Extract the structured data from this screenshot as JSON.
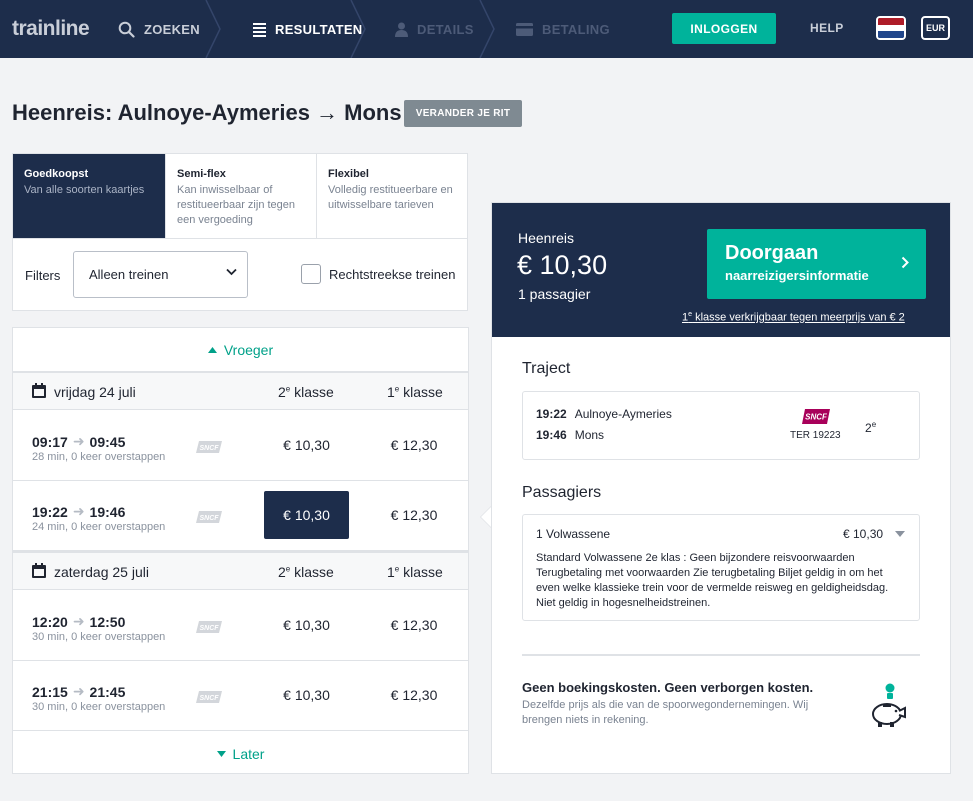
{
  "nav": {
    "logo": "trainline",
    "steps": [
      {
        "label": "ZOEKEN",
        "state": "done"
      },
      {
        "label": "RESULTATEN",
        "state": "active"
      },
      {
        "label": "DETAILS",
        "state": "disabled"
      },
      {
        "label": "BETALING",
        "state": "disabled"
      }
    ],
    "login": "INLOGGEN",
    "help": "HELP",
    "currency": "EUR",
    "flag_colors": [
      "#ae1c28",
      "#ffffff",
      "#21468b"
    ]
  },
  "heading": {
    "title": "Heenreis: Aulnoye-Aymeries → Mons",
    "change_button": "VERANDER JE RIT"
  },
  "fare_tabs": [
    {
      "title": "Goedkoopst",
      "desc": "Van alle soorten kaartjes",
      "active": true
    },
    {
      "title": "Semi-flex",
      "desc": "Kan inwisselbaar of restitueerbaar zijn tegen een vergoeding",
      "active": false
    },
    {
      "title": "Flexibel",
      "desc": "Volledig restitueerbare en uitwisselbare tarieven",
      "active": false
    }
  ],
  "filters": {
    "label": "Filters",
    "select_value": "Alleen treinen",
    "checkbox_label": "Rechtstreekse treinen",
    "checkbox_checked": false
  },
  "results": {
    "earlier": "Vroeger",
    "later": "Later",
    "class2": "2",
    "class1": "1",
    "class_sup": "e",
    "class_word": " klasse",
    "days": [
      {
        "date": "vrijdag 24 juli",
        "journeys": [
          {
            "dep": "09:17",
            "arr": "09:45",
            "info": "28 min, 0 keer overstappen",
            "price2": "€ 10,30",
            "price1": "€ 12,30",
            "selected": false
          },
          {
            "dep": "19:22",
            "arr": "19:46",
            "info": "24 min, 0 keer overstappen",
            "price2": "€ 10,30",
            "price1": "€ 12,30",
            "selected": true
          }
        ]
      },
      {
        "date": "zaterdag 25 juli",
        "journeys": [
          {
            "dep": "12:20",
            "arr": "12:50",
            "info": "30 min, 0 keer overstappen",
            "price2": "€ 10,30",
            "price1": "€ 12,30",
            "selected": false
          },
          {
            "dep": "21:15",
            "arr": "21:45",
            "info": "30 min, 0 keer overstappen",
            "price2": "€ 10,30",
            "price1": "€ 12,30",
            "selected": false
          }
        ]
      }
    ],
    "operator": "SNCF"
  },
  "summary": {
    "label": "Heenreis",
    "price": "€ 10,30",
    "passengers": "1 passagier",
    "go_title": "Doorgaan",
    "go_sub": "naarreizigersinformatie",
    "first_class_sup": "1",
    "first_class_e": "e",
    "first_class_text": " klasse verkrijgbaar tegen meerprijs van € 2",
    "traject_title": "Traject",
    "traject": {
      "dep_time": "19:22",
      "dep_station": "Aulnoye-Aymeries",
      "arr_time": "19:46",
      "arr_station": "Mons",
      "operator": "SNCF",
      "train": "TER 19223",
      "class": "2",
      "class_sup": "e"
    },
    "passengers_title": "Passagiers",
    "passenger": {
      "name": "1 Volwassene",
      "price": "€ 10,30",
      "desc": "Standard Volwassene 2e klas : Geen bijzondere reisvoorwaarden Terugbetaling met voorwaarden Zie terugbetaling Biljet geldig in om het even welke klassieke trein voor de vermelde reisweg en geldigheidsdag. Niet geldig in hogesnelheidstreinen."
    },
    "nofee_title": "Geen boekingskosten. Geen verborgen kosten.",
    "nofee_text": "Dezelfde prijs als die van de spoorwegondernemingen. Wij brengen niets in rekening."
  },
  "colors": {
    "navy": "#1d2d4b",
    "accent": "#00b39b",
    "link_teal": "#00a189",
    "grey_button": "#7f8a92"
  }
}
